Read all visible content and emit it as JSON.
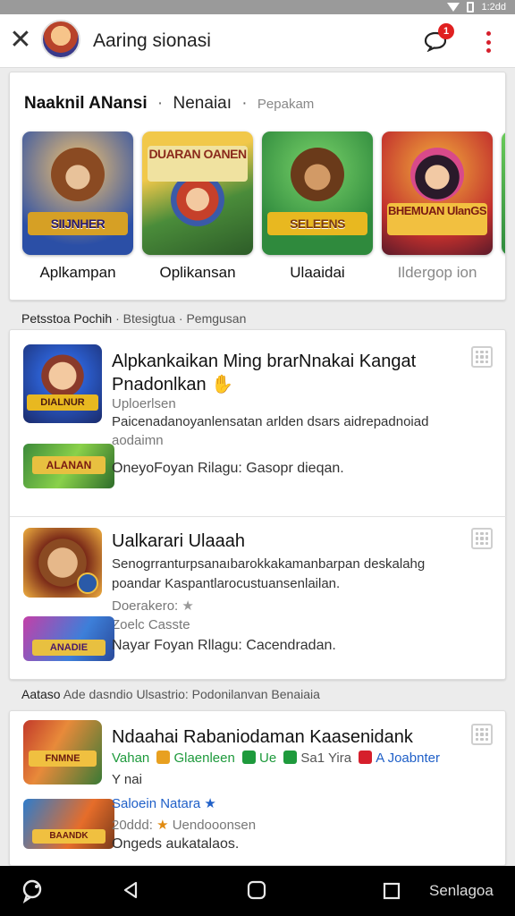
{
  "status_bar": {
    "time": "1:2dd"
  },
  "app_bar": {
    "title": "Aaring sionasi",
    "notification_count": "1"
  },
  "featured": {
    "title": "Naaknil ANansi",
    "dot": "·",
    "subtitle": "Nenaiaı",
    "subtitle2": "Pepakam",
    "tiles": [
      {
        "label": "Aplkampan",
        "banner": "SIIJNHER",
        "colors": [
          "#2b4fa6",
          "#f2a33a"
        ]
      },
      {
        "label": "Oplikansan",
        "banner": "DUARAN OANEN",
        "colors": [
          "#4a8c3a",
          "#e9c640"
        ]
      },
      {
        "label": "Ulaaidai",
        "banner": "SELEENS",
        "colors": [
          "#2f8a3d",
          "#f0c53a"
        ]
      },
      {
        "label": "Ildergop ion",
        "banner": "BHEMUAN UlanGS",
        "colors": [
          "#c2302d",
          "#f4b03c"
        ]
      }
    ]
  },
  "section1": {
    "title": "Petsstoa Pochih",
    "dot": "·",
    "tab1": "Btesigtua",
    "tab2": "Pemgusan"
  },
  "list1": [
    {
      "name_line1": "Alpkankaikan Ming brarNnakai Kangat",
      "name_line2": "Pnadonlkan",
      "meta": "Uploerlsen",
      "desc_line1": "Paicenadanoyanlensatan arlden dsars aidrepadnoiad",
      "desc_line2": "aodaimn",
      "sub_desc": "OneyoFoyan Rilagu: Gasopr dieqan.",
      "icon_banner": "DIALNUR",
      "thumb_banner": "ALANAN",
      "icon_colors": [
        "#2c5fd0",
        "#d8483c"
      ],
      "thumb_colors": [
        "#3c8a3a",
        "#e8c040"
      ]
    },
    {
      "name_line1": "Ualkarari Ulaaah",
      "desc_line1": "Senogrranturpsanaıbarokkakamanbarpan deskalahg",
      "desc_line2": "poandar Kaspantlarocustuansenlailan.",
      "meta": "Doerakero:",
      "meta2": "Zoelc Casste",
      "sub_desc": "Nayar Foyan Rllagu: Cacendradan.",
      "icon_banner": "",
      "thumb_banner": "ANADIE",
      "icon_colors": [
        "#7a2a18",
        "#f0b040"
      ],
      "thumb_colors": [
        "#c43fa8",
        "#3d7fd9"
      ]
    }
  ],
  "section2": {
    "title": "Aataso",
    "rest": "Ade dasndio Ulsastrio: Podonilanvan Benaiaia"
  },
  "list2": [
    {
      "name": "Ndaahai Rabaniodaman Kaasenidank",
      "tags": "Vahan",
      "tag2": "Glaenleen",
      "tag3": "Ue",
      "tag4": "Sa1 Yira",
      "tag5": "A Joabnter",
      "meta": "Y nai",
      "rating_label": "Saloein Natara",
      "date": "20ddd:",
      "date_rest": "Uendooonsen",
      "sub_desc": "Ongeds aukatalaos.",
      "icon_banner": "FNMNE",
      "thumb_banner": "BAANDK",
      "icon_colors": [
        "#c23a2a",
        "#3a7a36"
      ],
      "thumb_colors": [
        "#2e7ccc",
        "#e66d2a"
      ]
    }
  ],
  "nav_bar": {
    "label": "Senlagoa"
  },
  "colors": {
    "accent_red": "#d61f2c",
    "green": "#1e9a3c",
    "blue": "#2060c8"
  }
}
